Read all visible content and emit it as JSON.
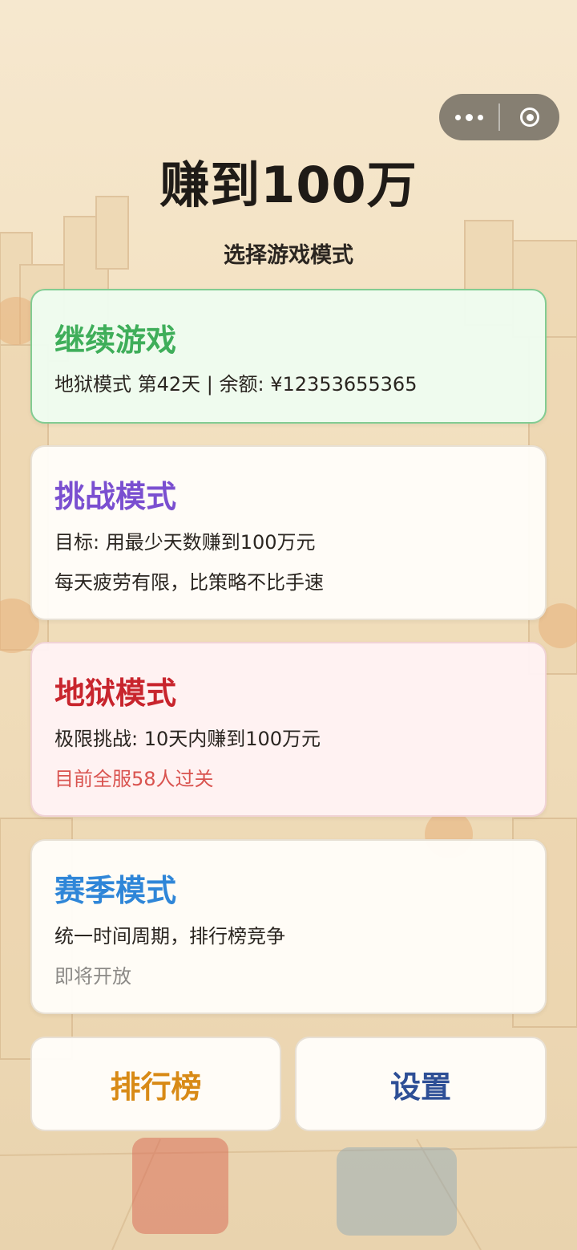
{
  "app": {
    "title": "赚到100万",
    "subtitle": "选择游戏模式"
  },
  "capsule": {
    "more_icon": "more-dots-icon",
    "close_icon": "target-circle-icon"
  },
  "modes": {
    "continue": {
      "title": "继续游戏",
      "line1": "地狱模式 第42天 | 余额: ¥12353655365",
      "color": "#3fae5a"
    },
    "challenge": {
      "title": "挑战模式",
      "line1": "目标: 用最少天数赚到100万元",
      "line2": "每天疲劳有限，比策略不比手速",
      "color": "#7a4fd0"
    },
    "hell": {
      "title": "地狱模式",
      "line1": "极限挑战: 10天内赚到100万元",
      "line2": "目前全服58人过关",
      "color": "#c8252d"
    },
    "season": {
      "title": "赛季模式",
      "line1": "统一时间周期，排行榜竞争",
      "line2": "即将开放",
      "color": "#2f86d8"
    }
  },
  "buttons": {
    "leaderboard": "排行榜",
    "settings": "设置"
  }
}
